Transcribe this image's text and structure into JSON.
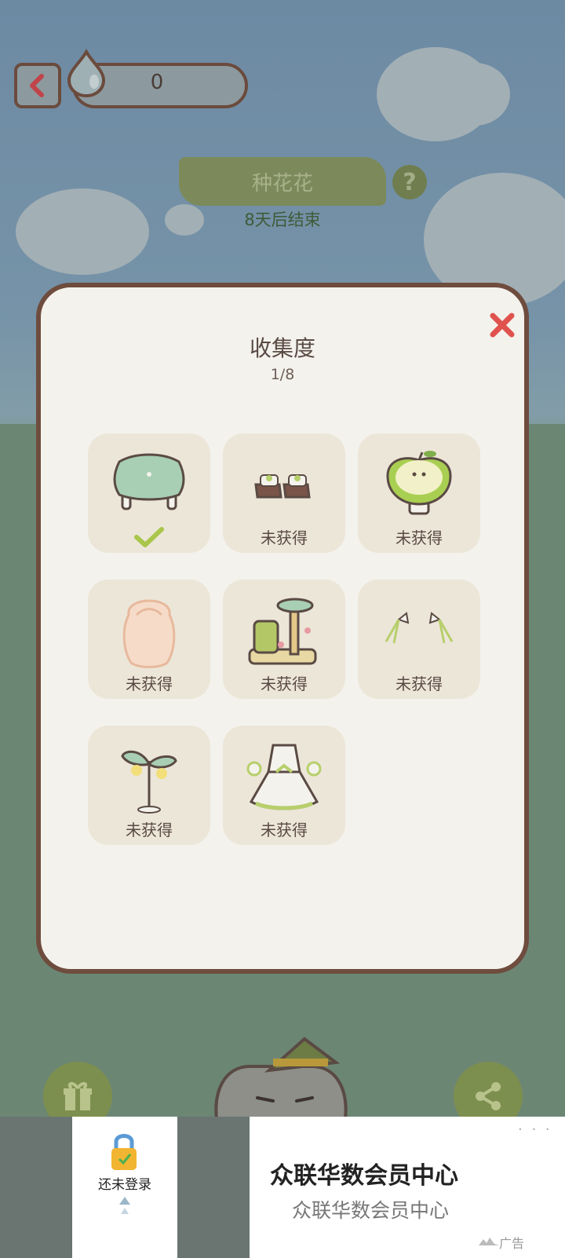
{
  "header": {
    "water_count": "0",
    "event_title": "种花花",
    "help_symbol": "?",
    "countdown": "8天后结束"
  },
  "modal": {
    "title": "收集度",
    "progress": "1/8",
    "items": [
      {
        "icon": "mint-cushion-stool-icon",
        "status": "",
        "obtained": true
      },
      {
        "icon": "slippers-icon",
        "status": "未获得",
        "obtained": false
      },
      {
        "icon": "apple-chair-icon",
        "status": "未获得",
        "obtained": false
      },
      {
        "icon": "curly-wig-icon",
        "status": "未获得",
        "obtained": false
      },
      {
        "icon": "cat-tree-icon",
        "status": "未获得",
        "obtained": false
      },
      {
        "icon": "ribbon-bows-icon",
        "status": "未获得",
        "obtained": false
      },
      {
        "icon": "sprout-lamp-icon",
        "status": "未获得",
        "obtained": false
      },
      {
        "icon": "flower-dress-icon",
        "status": "未获得",
        "obtained": false
      }
    ]
  },
  "ad": {
    "login_text": "还未登录",
    "title": "众联华数会员中心",
    "subtitle": "众联华数会员中心",
    "tag": "广告",
    "more": "· · ·"
  },
  "colors": {
    "modal_border": "#6e4c3e",
    "close_red": "#e0524e",
    "check_green": "#a9c64a",
    "cell_bg": "#ece6d8"
  }
}
